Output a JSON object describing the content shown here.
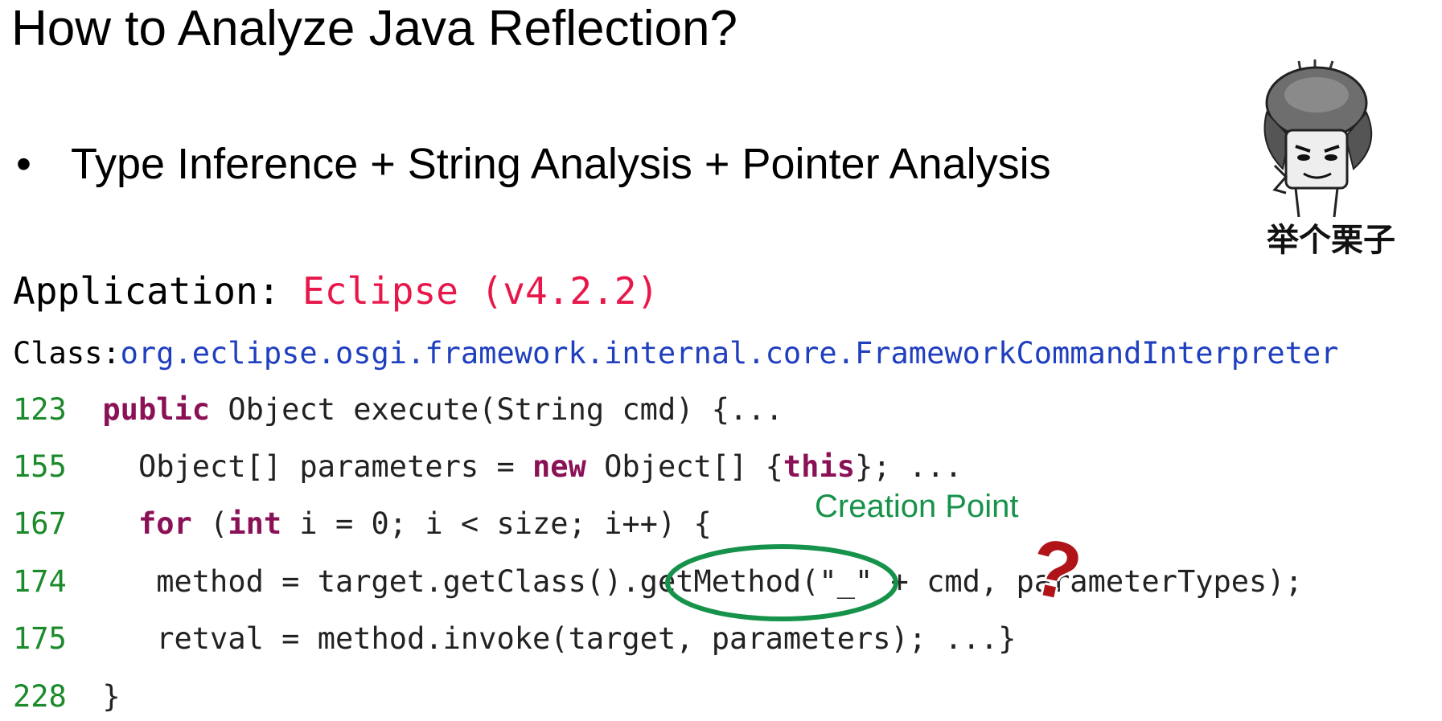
{
  "slide": {
    "title": "How to Analyze Java Reflection?",
    "bullet": {
      "symbol": "•",
      "text": "Type Inference + String Analysis + Pointer Analysis"
    },
    "meme": {
      "caption": "举个栗子"
    },
    "application": {
      "label": "Application: ",
      "value": "Eclipse (v4.2.2)"
    },
    "class_line": {
      "label": "Class:",
      "value": "org.eclipse.osgi.framework.internal.core.FrameworkCommandInterpreter"
    },
    "code": {
      "line_123": {
        "num": "123",
        "kw": "public",
        "rest": " Object execute(String cmd) {..."
      },
      "line_155": {
        "num": "155",
        "a": "  Object[] parameters = ",
        "kw1": "new",
        "b": " Object[] {",
        "kw2": "this",
        "c": "}; ..."
      },
      "line_167": {
        "num": "167",
        "kw1": "for",
        "a": " (",
        "kw2": "int",
        "b": " i = 0; i < size; i++) {"
      },
      "line_174": {
        "num": "174",
        "text": "   method = target.getClass().getMethod(\"_\" + cmd, parameterTypes);"
      },
      "line_175": {
        "num": "175",
        "text": "   retval = method.invoke(target, parameters); ...}"
      },
      "line_228": {
        "num": "228",
        "text": "}"
      }
    },
    "annotation": {
      "label": "Creation Point",
      "mark": "?"
    },
    "colors": {
      "line_numbers": "#1a8a2a",
      "keywords": "#8a1156",
      "application_value": "#e8174a",
      "class_value": "#1f3fbf",
      "annotation": "#16924a",
      "question_mark": "#b01418"
    }
  }
}
